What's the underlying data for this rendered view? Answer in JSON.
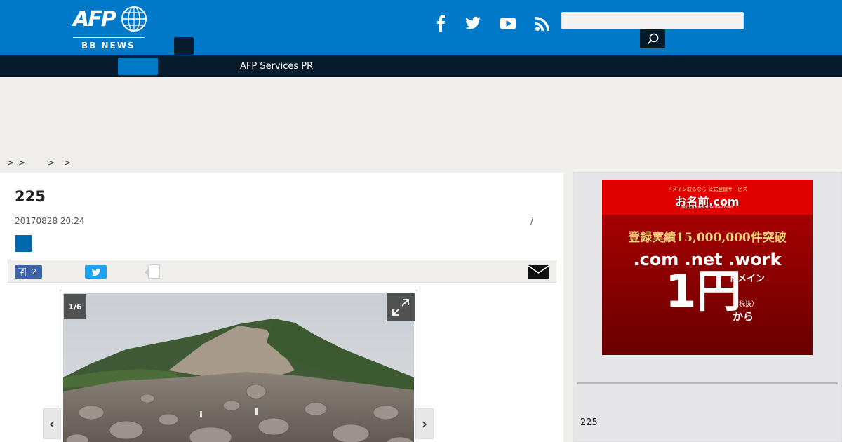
{
  "header": {
    "logo_text": "AFP",
    "logo_sub": "BB NEWS",
    "social": [
      "facebook-icon",
      "twitter-icon",
      "youtube-icon",
      "rss-icon"
    ],
    "search_placeholder": "",
    "accent_color": "#0079c8",
    "dark_color": "#061b2b"
  },
  "nav": {
    "items": [
      "AFP Services PR"
    ]
  },
  "breadcrumb": {
    "separators": [
      ">",
      ">",
      ">",
      ">"
    ]
  },
  "article": {
    "title": "225",
    "date": "20170828 20:24",
    "meta_separator": "/",
    "share": {
      "facebook_count": "2"
    },
    "gallery": {
      "counter": "1/6",
      "prev": "‹",
      "next": "›"
    }
  },
  "sidebar": {
    "ad": {
      "small_text": "ドメイン取るなら 公式登録サービス",
      "brand": "お名前.com",
      "url": "http://www.onamae.com",
      "record": "登録実績15,000,000件突破",
      "tlds": ".com .net .work",
      "domain_label": "ドメイン",
      "price": "1円",
      "tax": "（税抜）",
      "from": "から"
    },
    "title": "225"
  }
}
